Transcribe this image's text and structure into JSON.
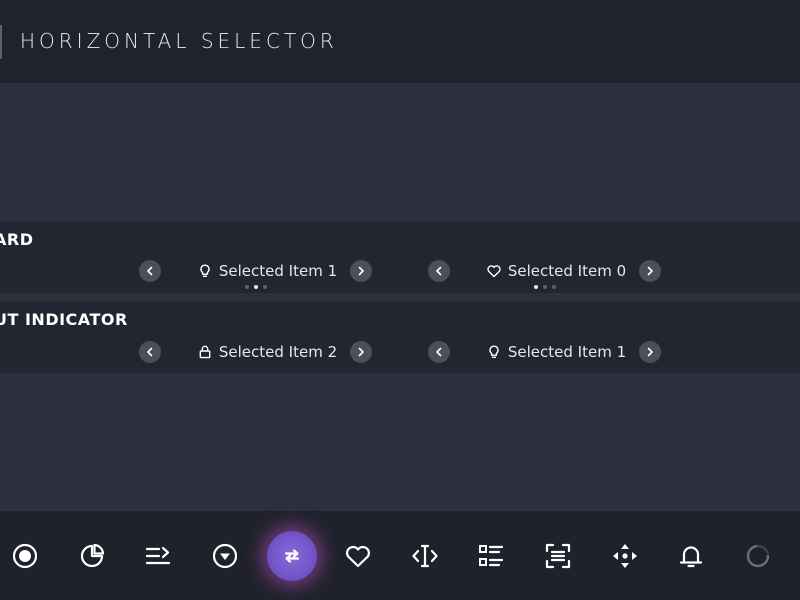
{
  "header": {
    "title": "HORIZONTAL SELECTOR"
  },
  "rows": [
    {
      "label": "ARD",
      "selectors": [
        {
          "icon": "lightbulb-icon",
          "text": "Selected Item 1",
          "dots": 3,
          "active": 1
        },
        {
          "icon": "heart-icon",
          "text": "Selected Item 0",
          "dots": 3,
          "active": 0
        }
      ]
    },
    {
      "label": "UT INDICATOR",
      "selectors": [
        {
          "icon": "lock-icon",
          "text": "Selected Item 2"
        },
        {
          "icon": "lightbulb-icon",
          "text": "Selected Item 1"
        }
      ]
    }
  ],
  "toolbar": {
    "items": [
      "radio-icon",
      "pie-chart-icon",
      "list-arrow-icon",
      "dropdown-icon",
      "swap-icon",
      "heart-icon",
      "text-cursor-icon",
      "checklist-icon",
      "scan-icon",
      "move-icon",
      "bell-icon",
      "refresh-icon"
    ],
    "active_index": 4
  },
  "colors": {
    "background": "#2c313d",
    "header": "#1f232d",
    "band": "#222630",
    "accent": "#7357c9",
    "glow": "#c050c0"
  }
}
